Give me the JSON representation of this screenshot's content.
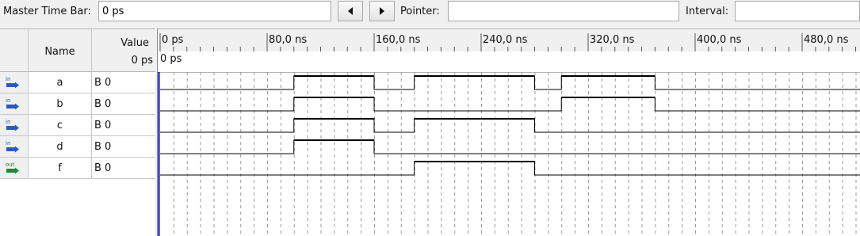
{
  "toolbar": {
    "master_time_bar_label": "Master Time Bar:",
    "master_time_bar_value": "0 ps",
    "pointer_label": "Pointer:",
    "pointer_value": "",
    "interval_label": "Interval:",
    "interval_value": ""
  },
  "table": {
    "name_header": "Name",
    "value_header": "Value",
    "value_subheader": "0 ps"
  },
  "cursor_label": "0 ps",
  "timeline": {
    "unit": "ns",
    "ticks": [
      {
        "t": 0,
        "label": "0 ps"
      },
      {
        "t": 80,
        "label": "80,0 ns"
      },
      {
        "t": 160,
        "label": "160,0 ns"
      },
      {
        "t": 240,
        "label": "240,0 ns"
      },
      {
        "t": 320,
        "label": "320,0 ns"
      },
      {
        "t": 400,
        "label": "400,0 ns"
      },
      {
        "t": 480,
        "label": "480,0 ns"
      }
    ],
    "visible_range_ns": [
      0,
      525
    ],
    "minor_step_ns": 10
  },
  "signals": [
    {
      "name": "a",
      "direction": "in",
      "value": "B 0",
      "high_intervals": [
        [
          100,
          160
        ],
        [
          190,
          280
        ],
        [
          300,
          370
        ]
      ]
    },
    {
      "name": "b",
      "direction": "in",
      "value": "B 0",
      "high_intervals": [
        [
          100,
          160
        ],
        [
          300,
          370
        ]
      ]
    },
    {
      "name": "c",
      "direction": "in",
      "value": "B 0",
      "high_intervals": [
        [
          100,
          160
        ],
        [
          190,
          280
        ]
      ]
    },
    {
      "name": "d",
      "direction": "in",
      "value": "B 0",
      "high_intervals": [
        [
          100,
          160
        ]
      ]
    },
    {
      "name": "f",
      "direction": "out",
      "value": "B 0",
      "high_intervals": [
        [
          190,
          280
        ]
      ]
    }
  ],
  "icons": {
    "in": {
      "text": "in",
      "color": "#2a5bb8"
    },
    "out": {
      "text": "out",
      "color": "#1f8a3c"
    },
    "prev": "triangle-left-icon",
    "next": "triangle-right-icon"
  },
  "colors": {
    "waveform": "#000000",
    "grid": "#9a9a9a",
    "cursor": "#0000cc"
  }
}
